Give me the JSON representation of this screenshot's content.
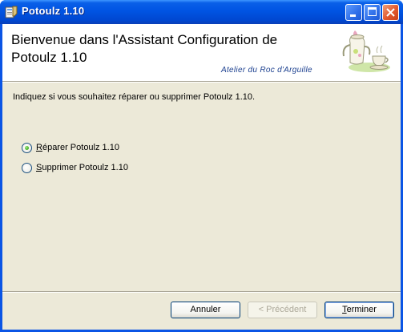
{
  "window": {
    "title": "Potoulz 1.10",
    "icon": "installer-icon",
    "controls": [
      "minimize-icon",
      "maximize-icon",
      "close-icon"
    ]
  },
  "banner": {
    "title": "Bienvenue dans l'Assistant Configuration de Potoulz 1.10",
    "company": "Atelier du Roc d'Arguille",
    "art": "teapot-cup-illustration"
  },
  "main": {
    "instruction": "Indiquez si vous souhaitez réparer ou supprimer Potoulz 1.10.",
    "options": [
      {
        "accel": "R",
        "rest": "éparer Potoulz 1.10",
        "selected": true
      },
      {
        "accel": "S",
        "rest": "upprimer Potoulz 1.10",
        "selected": false
      }
    ]
  },
  "buttons": {
    "cancel": "Annuler",
    "previous": "< Précédent",
    "finish_accel": "T",
    "finish_rest": "erminer"
  },
  "colors": {
    "titlebar": "#0054e3",
    "dialog_bg": "#ece9d8",
    "company_text": "#1b3f8f",
    "radio_dot": "#3fae1e"
  }
}
